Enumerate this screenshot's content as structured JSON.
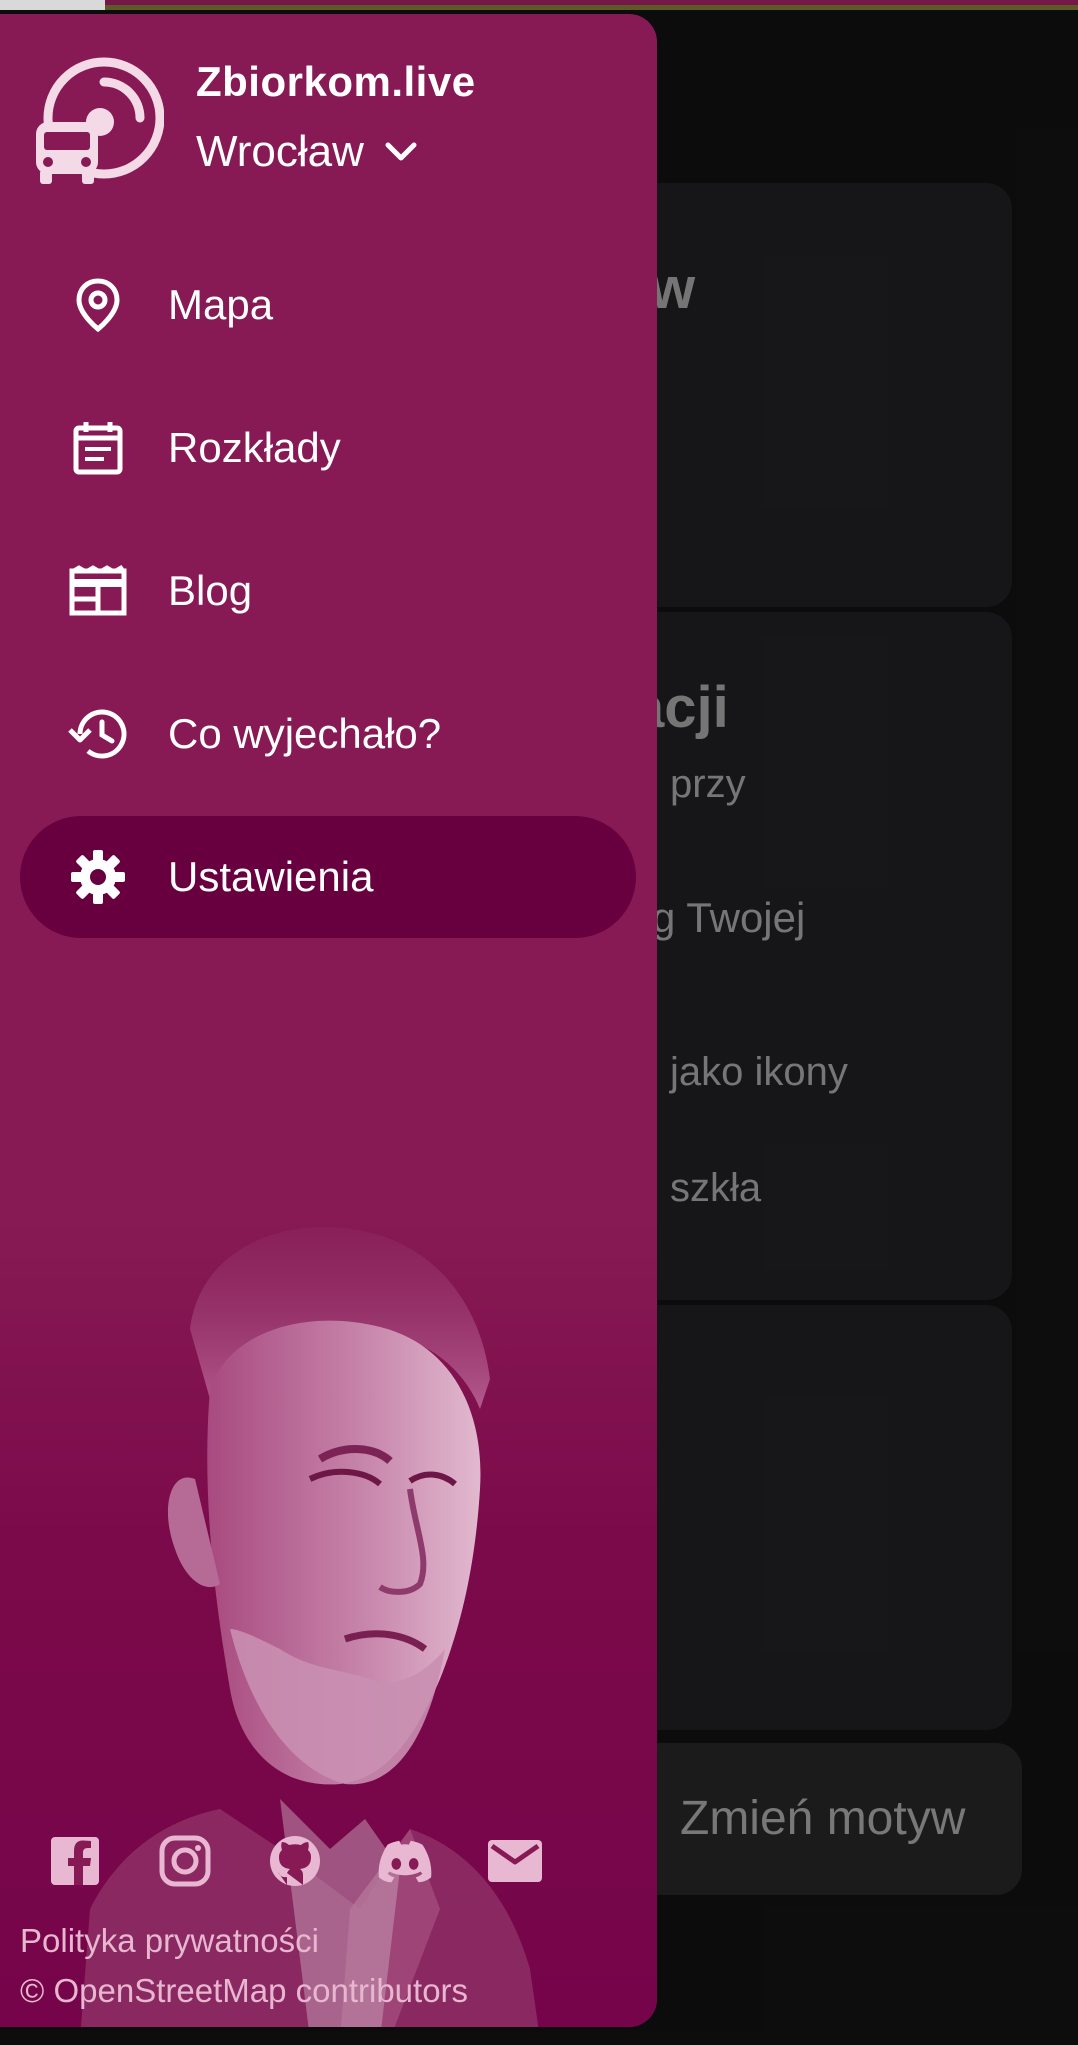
{
  "app": {
    "name": "Zbiorkom.live",
    "city": "Wrocław"
  },
  "nav": {
    "items": [
      {
        "label": "Mapa",
        "icon": "map-pin-icon"
      },
      {
        "label": "Rozkłady",
        "icon": "calendar-icon"
      },
      {
        "label": "Blog",
        "icon": "newspaper-icon"
      },
      {
        "label": "Co wyjechało?",
        "icon": "history-icon"
      },
      {
        "label": "Ustawienia",
        "icon": "gear-icon",
        "active": true
      }
    ]
  },
  "socials": [
    "facebook-icon",
    "instagram-icon",
    "github-icon",
    "discord-icon",
    "mail-icon"
  ],
  "footer": {
    "privacy": "Polityka prywatności",
    "credit": "© OpenStreetMap contributors"
  },
  "background_page": {
    "card1_heading_fragment": "w",
    "card2_heading_fragment": "acji",
    "card2_lines": [
      "przy",
      "g Twojej",
      "jako ikony",
      "szkła"
    ],
    "button_label": "Zmień motyw"
  },
  "colors": {
    "drawer": "#871a55",
    "active_item": "#680040",
    "page_bg": "#0f0f10",
    "card_bg": "#1b1b1d"
  }
}
